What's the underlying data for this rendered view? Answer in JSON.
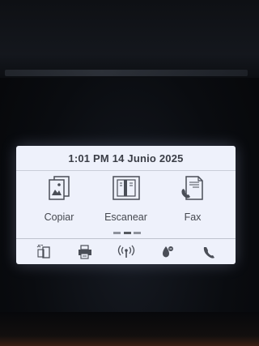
{
  "status": {
    "datetime": "1:01 PM 14 Junio 2025"
  },
  "apps": [
    {
      "label": "Copiar",
      "icon": "copy-icon"
    },
    {
      "label": "Escanear",
      "icon": "scan-icon"
    },
    {
      "label": "Fax",
      "icon": "fax-icon"
    }
  ],
  "pager": {
    "pages": 3,
    "active_page": 2
  },
  "dock": [
    {
      "icon": "mobile-print-icon"
    },
    {
      "icon": "printer-status-icon"
    },
    {
      "icon": "wireless-icon"
    },
    {
      "icon": "ink-level-icon"
    },
    {
      "icon": "phone-icon"
    }
  ],
  "colors": {
    "screen_background": "#eef1fb",
    "text": "#45484f",
    "icon_stroke": "#4a4e57"
  }
}
